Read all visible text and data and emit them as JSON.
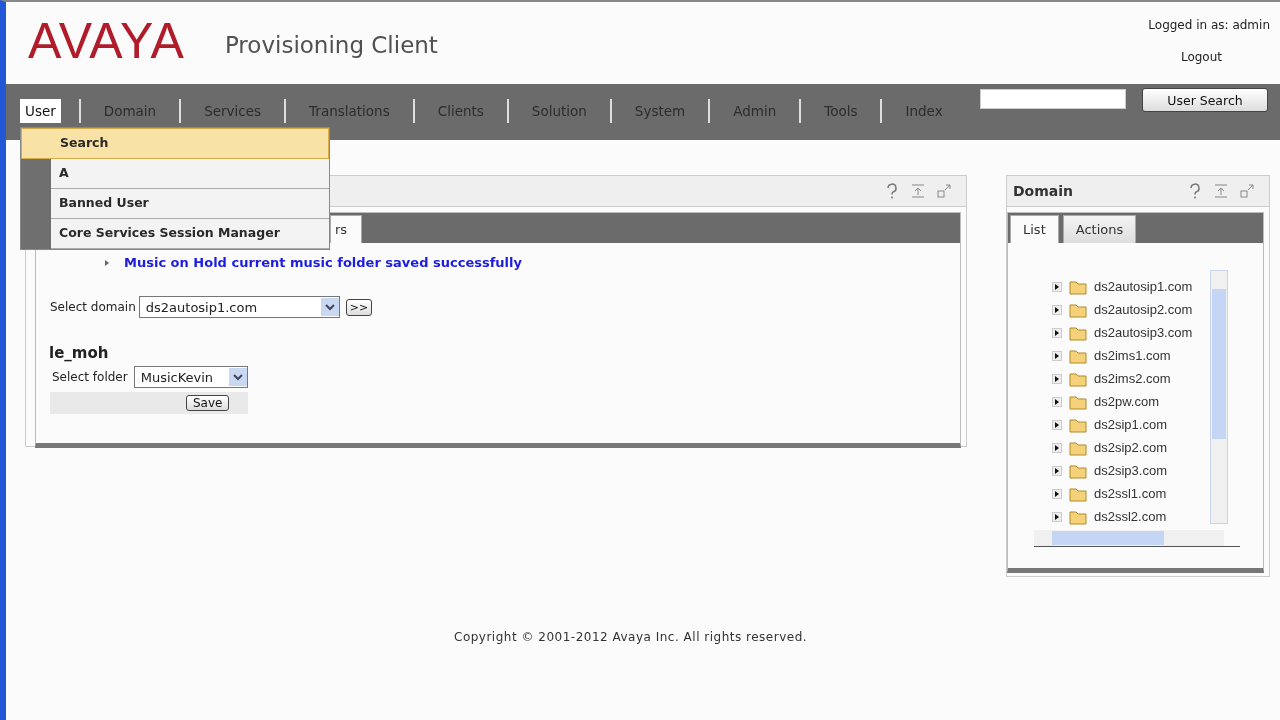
{
  "header": {
    "logo": "AVAYA",
    "app_title": "Provisioning Client",
    "logged_in": "Logged in as: admin",
    "logout": "Logout"
  },
  "nav": {
    "items": [
      {
        "label": "User",
        "selected": true
      },
      {
        "label": "Domain",
        "selected": false
      },
      {
        "label": "Services",
        "selected": false
      },
      {
        "label": "Translations",
        "selected": false
      },
      {
        "label": "Clients",
        "selected": false
      },
      {
        "label": "Solution",
        "selected": false
      },
      {
        "label": "System",
        "selected": false
      },
      {
        "label": "Admin",
        "selected": false
      },
      {
        "label": "Tools",
        "selected": false
      },
      {
        "label": "Index",
        "selected": false
      }
    ],
    "search_button": "User Search"
  },
  "user_menu": [
    {
      "label": "Search",
      "selected": true
    },
    {
      "label": "A",
      "selected": false
    },
    {
      "label": "Banned User",
      "selected": false
    },
    {
      "label": "Core Services Session Manager",
      "selected": false
    }
  ],
  "main_panel": {
    "tabs": [
      {
        "label": "rs",
        "selected": true
      }
    ],
    "message": "Music on Hold current music folder saved successfully",
    "domain_select": {
      "label": "Select domain",
      "value": "ds2autosip1.com"
    },
    "go_button": ">>",
    "section_title": "le_moh",
    "folder_select": {
      "label": "Select folder",
      "value": "MusicKevin"
    },
    "save_button": "Save"
  },
  "domain_panel": {
    "title": "Domain",
    "tabs": [
      {
        "label": "List",
        "selected": true
      },
      {
        "label": "Actions",
        "selected": false
      }
    ],
    "tree": [
      {
        "label": "ds2autosip1.com",
        "expanded": false
      },
      {
        "label": "ds2autosip2.com",
        "expanded": false
      },
      {
        "label": "ds2autosip3.com",
        "expanded": false
      },
      {
        "label": "ds2ims1.com",
        "expanded": false
      },
      {
        "label": "ds2ims2.com",
        "expanded": false
      },
      {
        "label": "ds2pw.com",
        "expanded": false
      },
      {
        "label": "ds2sip1.com",
        "expanded": false
      },
      {
        "label": "ds2sip2.com",
        "expanded": false
      },
      {
        "label": "ds2sip3.com",
        "expanded": false
      },
      {
        "label": "ds2ssl1.com",
        "expanded": false
      },
      {
        "label": "ds2ssl2.com",
        "expanded": false
      }
    ]
  },
  "footer": "Copyright © 2001-2012 Avaya Inc. All rights reserved."
}
